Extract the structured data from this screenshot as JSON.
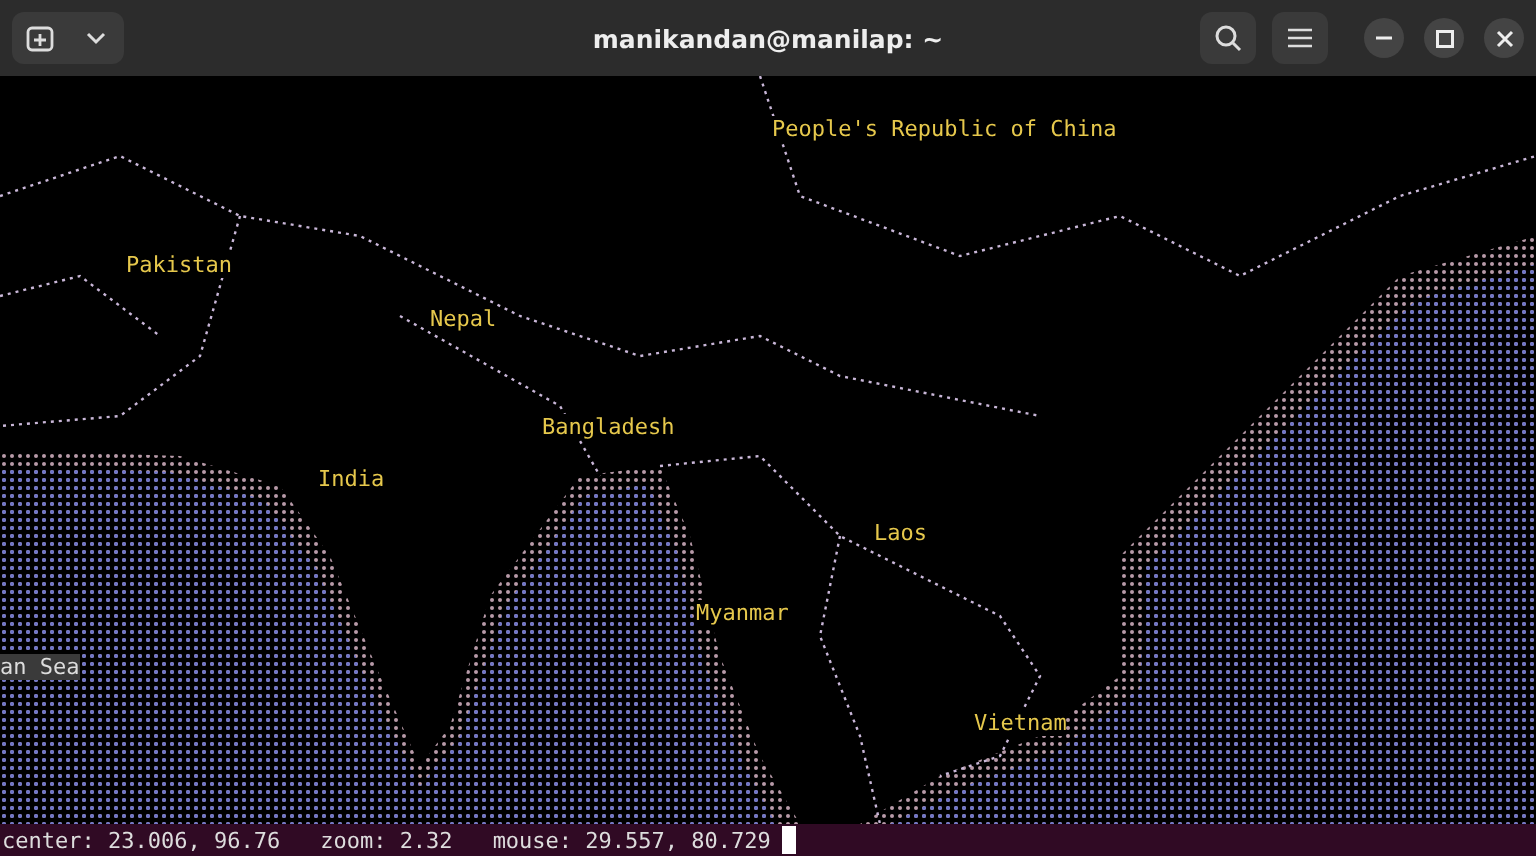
{
  "window": {
    "title": "manikandan@manilap: ~"
  },
  "map": {
    "labels": [
      {
        "text": "People's Republic of China"
      },
      {
        "text": "Pakistan"
      },
      {
        "text": "Nepal"
      },
      {
        "text": "Bangladesh"
      },
      {
        "text": "India"
      },
      {
        "text": "Laos"
      },
      {
        "text": "Myanmar"
      },
      {
        "text": "Vietnam"
      },
      {
        "text": "an Sea",
        "kind": "highlighted"
      }
    ]
  },
  "status_bar": {
    "items": [
      "center: 23.006, 96.76",
      "zoom: 2.32",
      "mouse: 29.557, 80.729"
    ]
  }
}
